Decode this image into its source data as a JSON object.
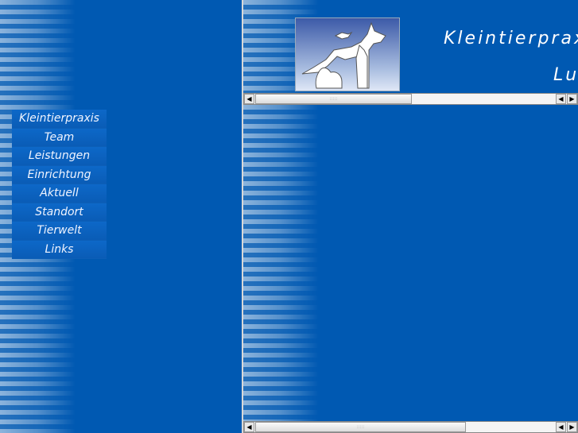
{
  "nav": {
    "items": [
      {
        "label": "Kleintierpraxis"
      },
      {
        "label": "Team"
      },
      {
        "label": "Leistungen"
      },
      {
        "label": "Einrichtung"
      },
      {
        "label": "Aktuell"
      },
      {
        "label": "Standort"
      },
      {
        "label": "Tierwelt"
      },
      {
        "label": "Links"
      }
    ]
  },
  "header": {
    "title": "Kleintierpraxis",
    "subtitle": "Lu"
  },
  "scroll": {
    "top_position_percent": 0,
    "bottom_position_percent": 0
  },
  "colors": {
    "background": "#0059b2"
  }
}
